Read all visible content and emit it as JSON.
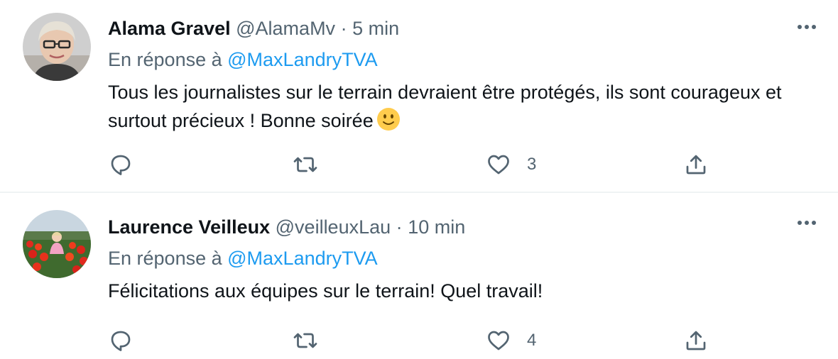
{
  "tweets": [
    {
      "name": "Alama Gravel",
      "handle": "@AlamaMv",
      "separator": "·",
      "time": "5 min",
      "reply_prefix": "En réponse à",
      "reply_to": "@MaxLandryTVA",
      "text": "Tous les journalistes sur le terrain devraient être protégés, ils sont courageux et surtout précieux ! Bonne soirée",
      "emoji": "slightly-smiling-face",
      "like_count": "3"
    },
    {
      "name": "Laurence Veilleux",
      "handle": "@veilleuxLau",
      "separator": "·",
      "time": "10 min",
      "reply_prefix": "En réponse à",
      "reply_to": "@MaxLandryTVA",
      "text": "Félicitations aux équipes sur le terrain! Quel travail!",
      "like_count": "4"
    }
  ],
  "icons": {
    "more": "more-horizontal-icon",
    "reply": "reply-bubble-icon",
    "retweet": "retweet-icon",
    "like": "heart-icon",
    "share": "share-upload-icon"
  },
  "colors": {
    "text": "#0f1419",
    "secondary": "#536471",
    "link": "#1d9bf0",
    "divider": "#eff3f4"
  }
}
